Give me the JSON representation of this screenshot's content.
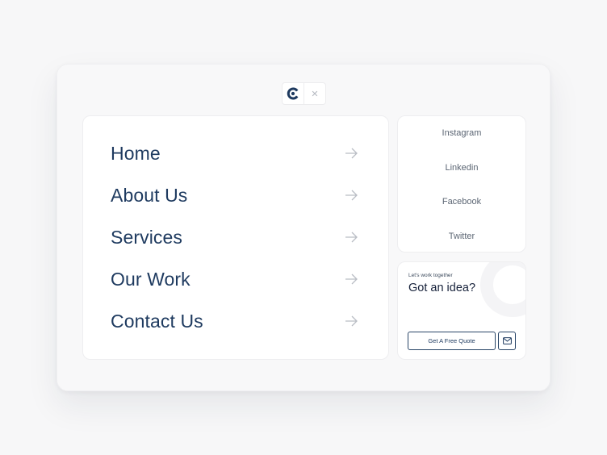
{
  "brand": {
    "logo_icon": "brand-c-logo-icon",
    "close_icon": "close-icon",
    "close_symbol": "✕"
  },
  "nav": {
    "items": [
      {
        "label": "Home"
      },
      {
        "label": "About Us"
      },
      {
        "label": "Services"
      },
      {
        "label": "Our Work"
      },
      {
        "label": "Contact Us"
      }
    ],
    "arrow_icon": "arrow-right-icon"
  },
  "social": {
    "links": [
      {
        "label": "Instagram"
      },
      {
        "label": "Linkedin"
      },
      {
        "label": "Facebook"
      },
      {
        "label": "Twitter"
      }
    ]
  },
  "cta": {
    "eyebrow": "Let's work together",
    "title": "Got an idea?",
    "quote_button": "Get A Free Quote",
    "mail_icon": "mail-icon"
  },
  "colors": {
    "primary": "#1e3a5f",
    "background": "#f7f7f8",
    "card": "#ffffff",
    "muted_text": "#5b6573",
    "arrow": "#b9bdc4"
  }
}
